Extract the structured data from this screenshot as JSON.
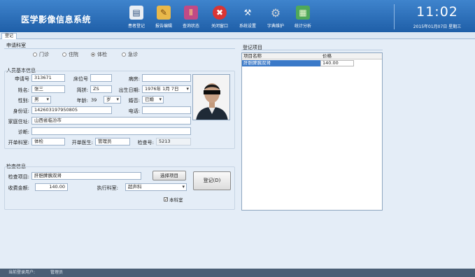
{
  "app": {
    "title": "医学影像信息系统",
    "time": "11:02",
    "date": "2015年01月07日  星期三"
  },
  "toolbar": [
    {
      "label": "患者登记",
      "icon": "patient-register-icon",
      "glyph": "▤",
      "color": "#e9eef4"
    },
    {
      "label": "报告编辑",
      "icon": "report-edit-icon",
      "glyph": "✎",
      "color": "#e8b84a"
    },
    {
      "label": "查询状态",
      "icon": "query-status-icon",
      "glyph": "Ⅱ",
      "color": "#c04a86"
    },
    {
      "label": "关闭窗口",
      "icon": "close-window-icon",
      "glyph": "✖",
      "color": "#d93535"
    },
    {
      "label": "系统设置",
      "icon": "system-settings-icon",
      "glyph": "⚒",
      "color": "#5b84b6"
    },
    {
      "label": "字典维护",
      "icon": "dictionary-icon",
      "glyph": "⚙",
      "color": "#9aa6b3"
    },
    {
      "label": "统计分析",
      "icon": "statistics-icon",
      "glyph": "▦",
      "color": "#4fa85a"
    }
  ],
  "tabs": {
    "active": "登记"
  },
  "request_dept": {
    "title": "申请科室",
    "options": [
      "门诊",
      "住院",
      "体检",
      "急诊"
    ],
    "selected": "体检"
  },
  "patient": {
    "title": "人员基本信息",
    "request_no_label": "申请号",
    "request_no": "313671",
    "bed_no_label": "床位号",
    "bed_no": "",
    "room_label": "病房:",
    "room": "",
    "name_label": "姓名:",
    "name": "张三",
    "pinyin_label": "简拼:",
    "pinyin": "ZS",
    "birth_label": "出生日期:",
    "birth": "1976年  1月  7日",
    "gender_label": "性别:",
    "gender": "男",
    "age_label": "年龄:",
    "age": "39",
    "age_unit": "岁",
    "marital_label": "婚否:",
    "marital": "已婚",
    "id_label": "身份证:",
    "id_no": "142603197950805",
    "phone_label": "电话:",
    "phone": "",
    "address_label": "家庭住址:",
    "address": "山西省临汾市",
    "diagnosis_label": "诊断:",
    "diagnosis": "",
    "dept_label": "开单科室:",
    "dept": "体检",
    "doctor_label": "开单医生:",
    "doctor": "管理员",
    "exam_no_label": "检查号:",
    "exam_no": "5213"
  },
  "exam": {
    "title": "检查信息",
    "item_label": "检查项目:",
    "item": "肝胆脾胰双肾",
    "select_button": "选择项目",
    "fee_label": "收费金额:",
    "fee": "140.00",
    "exec_dept_label": "执行科室:",
    "exec_dept": "超声科",
    "register_button": "登记(D)",
    "this_dept_label": "本科室",
    "this_dept_checked": true
  },
  "registered_items": {
    "title": "登记项目",
    "columns": [
      "项目名称",
      "价格"
    ],
    "rows": [
      {
        "name": "肝胆脾胰双肾",
        "price": "140.00"
      }
    ]
  },
  "status_bar": {
    "user_label": "当前登录用户:",
    "user": "管理员"
  }
}
